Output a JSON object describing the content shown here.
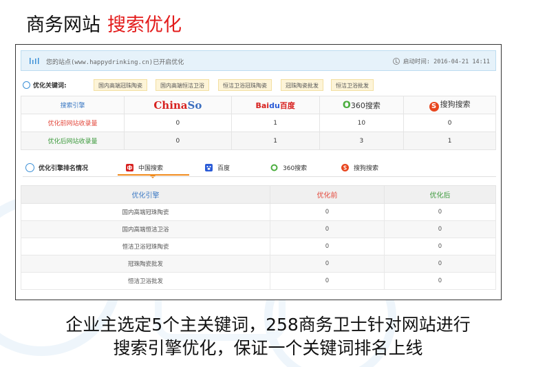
{
  "slide": {
    "title_black": "商务网站",
    "title_red": "搜索优化"
  },
  "status_bar": {
    "site_text": "您的站点(www.happydrinking.cn)已开启优化",
    "start_time": "启动时间: 2016-04-21 14:11"
  },
  "keywords": {
    "label": "优化关键词:",
    "tags": [
      "国内高端冠珠陶瓷",
      "国内高端恒洁卫浴",
      "恒洁卫浴冠珠陶瓷",
      "冠珠陶瓷批发",
      "恒洁卫浴批发"
    ]
  },
  "engine_table": {
    "corner_label": "搜索引擎",
    "engines": [
      {
        "name": "ChinaSo",
        "icon": "chinaso-logo"
      },
      {
        "name": "Bai百度",
        "icon": "baidu-logo"
      },
      {
        "name": "360搜索",
        "icon": "360-logo"
      },
      {
        "name": "搜狗搜索",
        "icon": "sogou-logo"
      }
    ],
    "logo_text": {
      "chinaso_a": "China",
      "chinaso_b": "So",
      "baidu_a": "Bai",
      "baidu_paw": "du",
      "baidu_b": "百度",
      "o360": "O",
      "t360": "360搜索",
      "sogou_s": "S",
      "sogou": "搜狗搜索"
    },
    "rows": [
      {
        "label": "优化前网站收录量",
        "values": [
          "0",
          "1",
          "10",
          "0"
        ]
      },
      {
        "label": "优化后网站收录量",
        "values": [
          "0",
          "1",
          "3",
          "1"
        ]
      }
    ]
  },
  "ranking": {
    "title": "优化引擎排名情况",
    "tabs": [
      "中国搜索",
      "百度",
      "360搜索",
      "搜狗搜索"
    ],
    "active_tab": "中国搜索",
    "headers": [
      "优化引擎",
      "优化前",
      "优化后"
    ],
    "rows": [
      [
        "国内高端冠珠陶瓷",
        "0",
        "0"
      ],
      [
        "国内高端恒洁卫浴",
        "0",
        "0"
      ],
      [
        "恒洁卫浴冠珠陶瓷",
        "0",
        "0"
      ],
      [
        "冠珠陶瓷批发",
        "0",
        "0"
      ],
      [
        "恒洁卫浴批发",
        "0",
        "0"
      ]
    ]
  },
  "caption": {
    "line1": "企业主选定5个主关键词，258商务卫士针对网站进行",
    "line2": "搜索引擎优化，保证一个关键词排名上线"
  },
  "colors": {
    "title_red": "#e31b1b",
    "status_bg": "#e6f2fa",
    "tag_bg": "#fdf4d8",
    "before_red": "#e3473b",
    "after_green": "#3c9a3c",
    "engine_blue": "#3a78c3",
    "tab_orange": "#f08a1c"
  }
}
